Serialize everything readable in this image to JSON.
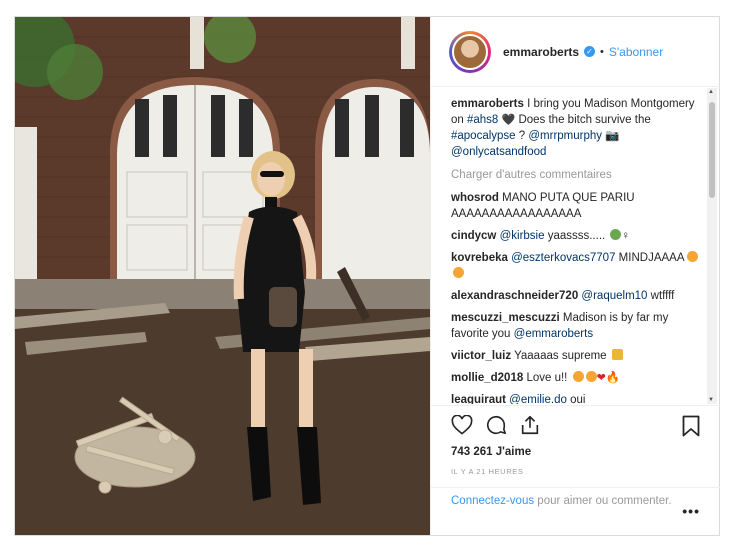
{
  "post": {
    "username": "emmaroberts",
    "follow_label": "S'abonner",
    "caption_prefix": "I bring you Madison Montgomery on ",
    "hashtag1": "#ahs8",
    "caption_mid": " Does the bitch survive the ",
    "hashtag2": "#apocalypse",
    "caption_q": " ? ",
    "mention1": "@mrrpmurphy",
    "mention2": "@onlycatsandfood",
    "load_more": "Charger d'autres commentaires",
    "comments": [
      {
        "user": "whosrod",
        "text": "MANO PUTA QUE PARIU AAAAAAAAAAAAAAAAA"
      },
      {
        "user": "cindycw",
        "mention": "@kirbsie",
        "text": " yaassss....."
      },
      {
        "user": "kovrebeka",
        "mention": "@eszterkovacs7707",
        "text": " MINDJAAAA"
      },
      {
        "user": "alexandraschneider720",
        "mention": "@raquelm10",
        "text": " wtffff"
      },
      {
        "user": "mescuzzi_mescuzzi",
        "text": "Madison is by far my favorite you ",
        "mention": "@emmaroberts"
      },
      {
        "user": "viictor_luiz",
        "text": "Yaaaaas supreme"
      },
      {
        "user": "mollie_d2018",
        "text": "Love u!!"
      },
      {
        "user": "leaguiraut",
        "mention": "@emilie.do",
        "text": " oui"
      }
    ],
    "likes": "743 261 J'aime",
    "time": "IL Y A 21 HEURES",
    "login_link": "Connectez-vous",
    "login_text": " pour aimer ou commenter.",
    "more": "•••"
  },
  "icons": [
    "heart-icon",
    "comment-icon",
    "share-icon",
    "bookmark-icon",
    "verified-icon",
    "more-icon"
  ],
  "colors": {
    "accent": "#3897f0",
    "mention": "#003569",
    "muted": "#999999"
  }
}
